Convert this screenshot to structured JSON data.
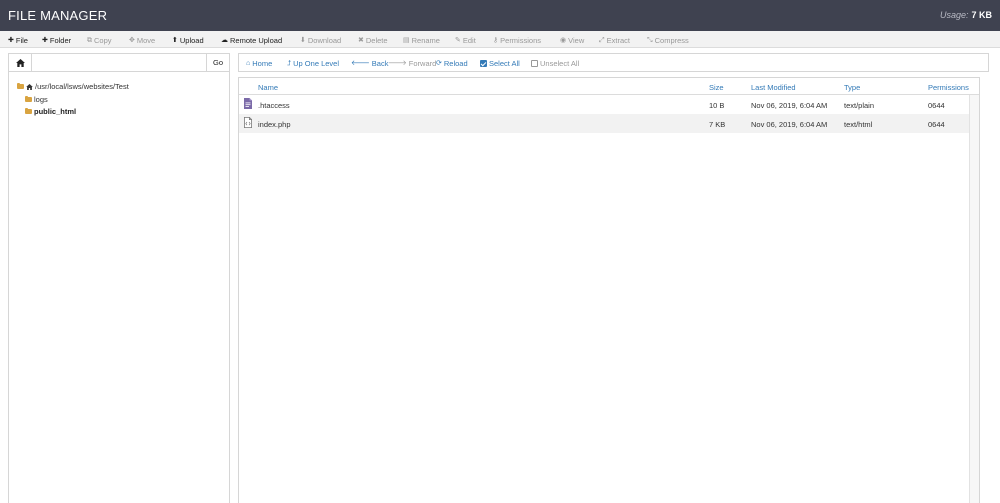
{
  "header": {
    "title": "FILE MANAGER",
    "usage_label": "Usage:",
    "usage_value": "7 KB"
  },
  "toolbar": {
    "file": "File",
    "folder": "Folder",
    "copy": "Copy",
    "move": "Move",
    "upload": "Upload",
    "remote_upload": "Remote Upload",
    "download": "Download",
    "delete": "Delete",
    "rename": "Rename",
    "edit": "Edit",
    "permissions": "Permissions",
    "view": "View",
    "extract": "Extract",
    "compress": "Compress"
  },
  "pathbar": {
    "value": "",
    "go_label": "Go"
  },
  "tree": {
    "root": "/usr/local/lsws/websites/Test",
    "items": [
      "logs",
      "public_html"
    ]
  },
  "nav": {
    "home": "Home",
    "up": "Up One Level",
    "back": "Back",
    "forward": "Forward",
    "reload": "Reload",
    "select_all": "Select All",
    "unselect_all": "Unselect All"
  },
  "table": {
    "columns": [
      "Name",
      "Size",
      "Last Modified",
      "Type",
      "Permissions"
    ],
    "rows": [
      {
        "name": ".htaccess",
        "size": "10 B",
        "modified": "Nov 06, 2019, 6:04 AM",
        "type": "text/plain",
        "perms": "0644",
        "icon": "text-file-icon"
      },
      {
        "name": "index.php",
        "size": "7 KB",
        "modified": "Nov 06, 2019, 6:04 AM",
        "type": "text/html",
        "perms": "0644",
        "icon": "code-file-icon"
      }
    ]
  },
  "colors": {
    "header_bg": "#3f4250",
    "link": "#337ab7",
    "folder": "#d9a441",
    "file_icon": "#7b6aa8"
  }
}
